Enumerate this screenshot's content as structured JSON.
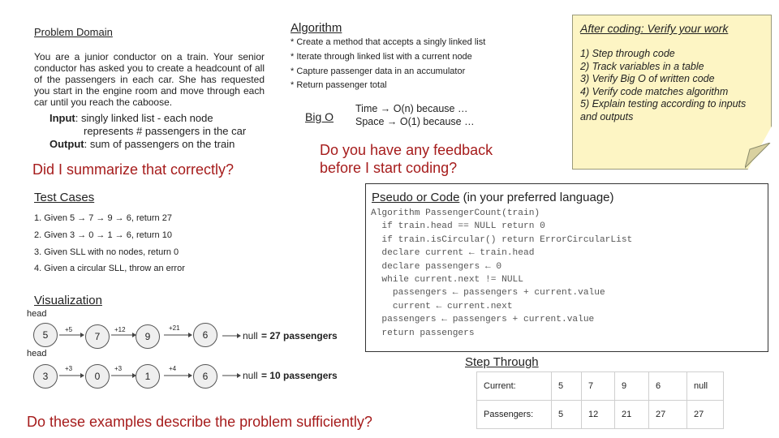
{
  "problem_domain": {
    "title": "Problem Domain",
    "body": "You are a junior conductor on a train. Your senior conductor has asked you to create a headcount of all of the passengers in each car. She has requested you start in the engine room and move through each car until you reach the caboose.",
    "input_label": "Input",
    "input_text_1": ": singly linked list - each node",
    "input_text_2": "represents # passengers in the car",
    "output_label": "Output",
    "output_text": ": sum of passengers on the train",
    "question": "Did I summarize that correctly?"
  },
  "algorithm": {
    "title": "Algorithm",
    "items": [
      "* Create a method that accepts a singly linked list",
      "* Iterate through linked list with a current node",
      "* Capture passenger data in an accumulator",
      "* Return passenger total"
    ]
  },
  "big_o": {
    "title": "Big O",
    "time": "Time → O(n) because …",
    "space": "Space → O(1) because …"
  },
  "feedback_question": "Do you have any feedback\nbefore I start coding?",
  "sticky": {
    "title": "After coding: Verify your work",
    "steps": [
      "1) Step through code",
      "2) Track variables in a table",
      "3) Verify Big O of written code",
      "4) Verify code matches algorithm",
      "5) Explain testing according to inputs and outputs"
    ]
  },
  "test_cases": {
    "title": "Test Cases",
    "items": [
      "1. Given 5 → 7 → 9 → 6, return 27",
      "2. Given 3 → 0 → 1 → 6, return 10",
      "3. Given SLL with no nodes, return 0",
      "4. Given a circular SLL, throw an error"
    ]
  },
  "code": {
    "title_main": "Pseudo or Code",
    "title_sub": " (in your preferred language)",
    "lines": [
      "Algorithm PassengerCount(train)",
      "  if train.head == NULL return 0",
      "  if train.isCircular() return ErrorCircularList",
      "  declare current ← train.head",
      "  declare passengers ← 0",
      "  while current.next != NULL",
      "    passengers ← passengers + current.value",
      "    current ← current.next",
      "  passengers ← passengers + current.value",
      "  return passengers"
    ]
  },
  "visualization": {
    "title": "Visualization",
    "lists": [
      {
        "head_label": "head",
        "nodes": [
          "5",
          "7",
          "9",
          "6"
        ],
        "increments": [
          "+5",
          "+12",
          "+21"
        ],
        "null_label": "null",
        "result": "= 27 passengers"
      },
      {
        "head_label": "head",
        "nodes": [
          "3",
          "0",
          "1",
          "6"
        ],
        "increments": [
          "+3",
          "+3",
          "+4"
        ],
        "null_label": "null",
        "result": "= 10 passengers"
      }
    ]
  },
  "step_through": {
    "title": "Step Through",
    "rows": [
      {
        "label": "Current:",
        "values": [
          "5",
          "7",
          "9",
          "6",
          "null"
        ]
      },
      {
        "label": "Passengers:",
        "values": [
          "5",
          "12",
          "21",
          "27",
          "27"
        ]
      }
    ]
  },
  "bottom_question": "Do these examples describe the problem sufficiently?",
  "colors": {
    "accent_red": "#a61c1c",
    "sticky_bg": "#fdf5c4",
    "node_bg": "#efefef"
  }
}
